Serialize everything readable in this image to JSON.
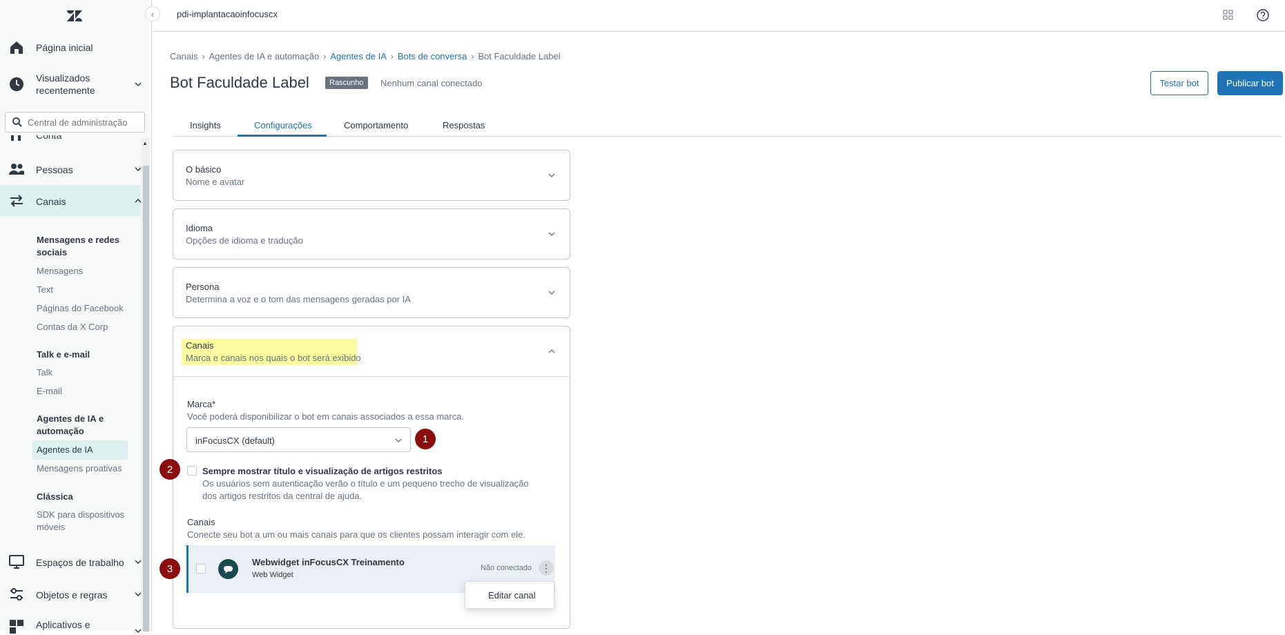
{
  "sidebar": {
    "collapse_glyph": "‹",
    "search_placeholder": "Central de administração",
    "top_items": [
      {
        "label": "Página inicial",
        "icon": "home-icon"
      },
      {
        "label": "Visualizados recentemente",
        "icon": "clock-icon"
      },
      {
        "label": "Conta",
        "icon": "account-icon"
      },
      {
        "label": "Pessoas",
        "icon": "people-icon"
      },
      {
        "label": "Canais",
        "icon": "channels-icon"
      },
      {
        "label": "Espaços de trabalho",
        "icon": "workspace-icon"
      },
      {
        "label": "Objetos e regras",
        "icon": "rules-icon"
      },
      {
        "label": "Aplicativos e",
        "icon": "apps-icon"
      }
    ],
    "visualizados_line1": "Visualizados",
    "visualizados_line2": "recentemente",
    "canais_groups": {
      "messaging_head_1": "Mensagens e redes",
      "messaging_head_2": "sociais",
      "messaging_items": [
        "Mensagens",
        "Text",
        "Páginas do Facebook",
        "Contas da X Corp"
      ],
      "talk_head": "Talk e e-mail",
      "talk_items": [
        "Talk",
        "E-mail"
      ],
      "ai_head_1": "Agentes de IA e",
      "ai_head_2": "automação",
      "ai_items": [
        "Agentes de IA",
        "Mensagens proativas"
      ],
      "classic_head": "Clássica",
      "classic_item_1": "SDK para dispositivos",
      "classic_item_2": "móveis"
    }
  },
  "topbar": {
    "account": "pdi-implantacaoinfocuscx"
  },
  "breadcrumbs": [
    "Canais",
    "Agentes de IA e automação",
    "Agentes de IA",
    "Bots de conversa",
    "Bot Faculdade Label"
  ],
  "header": {
    "title": "Bot Faculdade Label",
    "badge": "Rascunho",
    "status": "Nenhum canal conectado",
    "test_button": "Testar bot",
    "publish_button": "Publicar bot"
  },
  "tabs": [
    "Insights",
    "Configurações",
    "Comportamento",
    "Respostas"
  ],
  "panels": [
    {
      "title": "O básico",
      "subtitle": "Nome e avatar"
    },
    {
      "title": "Idioma",
      "subtitle": "Opções de idioma e tradução"
    },
    {
      "title": "Persona",
      "subtitle": "Determina a voz e o tom das mensagens geradas por IA"
    },
    {
      "title": "Canais",
      "subtitle": "Marca e canais nos quais o bot será exibido"
    }
  ],
  "canais_panel": {
    "brand_label": "Marca*",
    "brand_hint": "Você poderá disponibilizar o bot em canais associados a essa marca.",
    "brand_value": "inFocusCX (default)",
    "restricted_label": "Sempre mostrar título e visualização de artigos restritos",
    "restricted_desc": "Os usuários sem autenticação verão o título e um pequeno trecho de visualização dos artigos restritos da central de ajuda.",
    "channels_label": "Canais",
    "channels_hint": "Conecte seu bot a um ou mais canais para que os clientes possam interagir com ele.",
    "channel": {
      "name": "Webwidget inFocusCX Treinamento",
      "type": "Web Widget",
      "status": "Não conectado"
    },
    "menu_item": "Editar canal"
  },
  "markers": [
    "1",
    "2",
    "3"
  ],
  "colors": {
    "accent": "#1f73b7",
    "highlight": "#fafa9e",
    "marker": "#8b0e0e",
    "active_nav": "#def0ef",
    "badge": "#68737d"
  }
}
